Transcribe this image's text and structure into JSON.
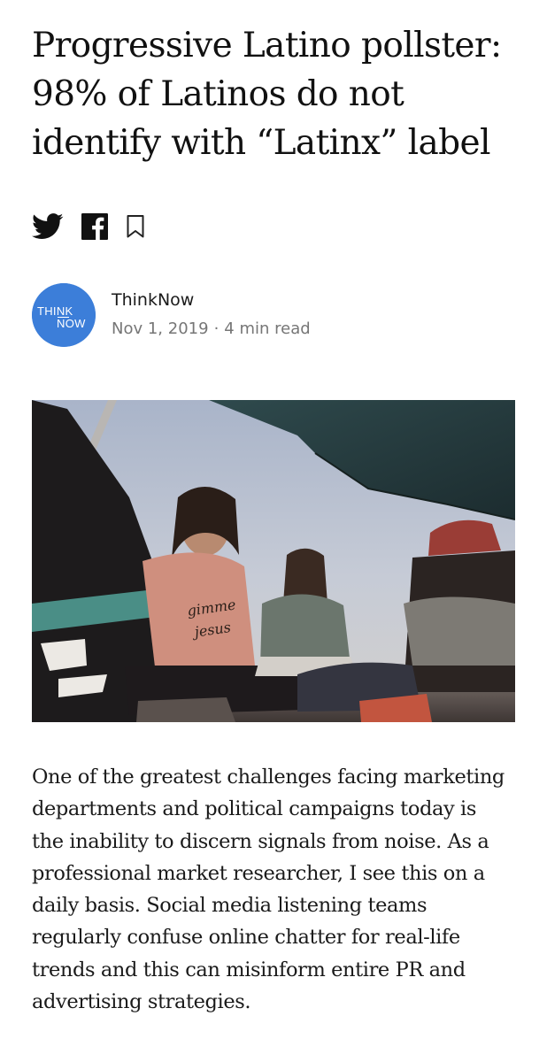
{
  "article": {
    "headline_lines": [
      "Progressive Latino pollster:",
      "98% of Latinos do not",
      "identify with “Latinx” label"
    ],
    "share": {
      "twitter_icon": "twitter-bird-icon",
      "facebook_icon": "facebook-f-icon",
      "bookmark_icon": "bookmark-icon"
    },
    "author": {
      "logo_text_top": "THINK",
      "logo_text_bottom": "NOW",
      "name": "ThinkNow",
      "date": "Nov 1, 2019",
      "separator": "·",
      "read_time": "4 min read"
    },
    "hero_image": {
      "description_icon": "photo-icon",
      "shirt_text_1": "gimme",
      "shirt_text_2": "jesus"
    },
    "body_lines": [
      "One of the greatest challenges facing marketing",
      "departments and political campaigns today is",
      "the inability to discern signals from noise. As a",
      "professional market researcher, I see this on a",
      "daily basis. Social media listening teams",
      "regularly confuse online chatter for real-life",
      "trends and this can misinform entire PR and",
      "advertising strategies."
    ],
    "colors": {
      "brand_blue": "#3c7ed9",
      "text": "#1a1a1a",
      "meta": "#767676"
    }
  }
}
